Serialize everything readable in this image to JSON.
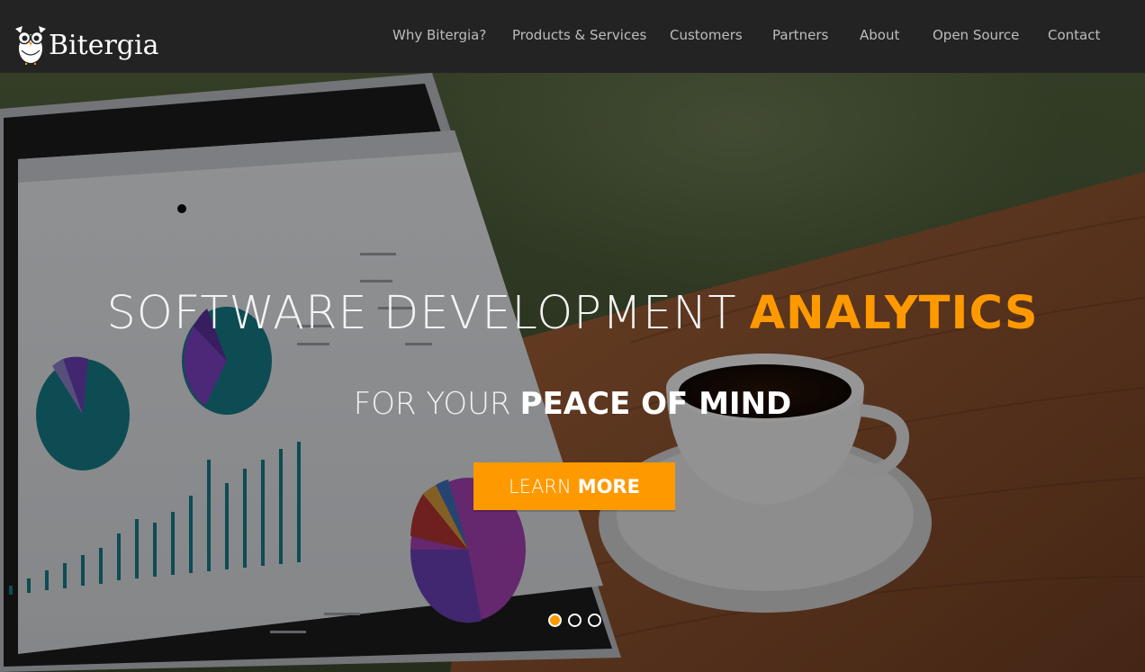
{
  "brand": {
    "name": "Bitergia",
    "logo_icon": "owl-icon"
  },
  "nav": {
    "items": [
      {
        "label": "Why Bitergia?"
      },
      {
        "label": "Products & Services"
      },
      {
        "label": "Customers"
      },
      {
        "label": "Partners"
      },
      {
        "label": "About"
      },
      {
        "label": "Open Source"
      },
      {
        "label": "Contact"
      }
    ]
  },
  "hero": {
    "headline_light": "SOFTWARE DEVELOPMENT",
    "headline_accent": "ANALYTICS",
    "subline_light": "FOR YOUR",
    "subline_bold": "PEACE OF MIND",
    "cta_light": "LEARN",
    "cta_bold": "MORE",
    "slides_total": 3,
    "slide_active": 1
  },
  "colors": {
    "accent": "#ff9900",
    "navbar_bg": "#232323",
    "nav_text": "#bdbdbd"
  }
}
